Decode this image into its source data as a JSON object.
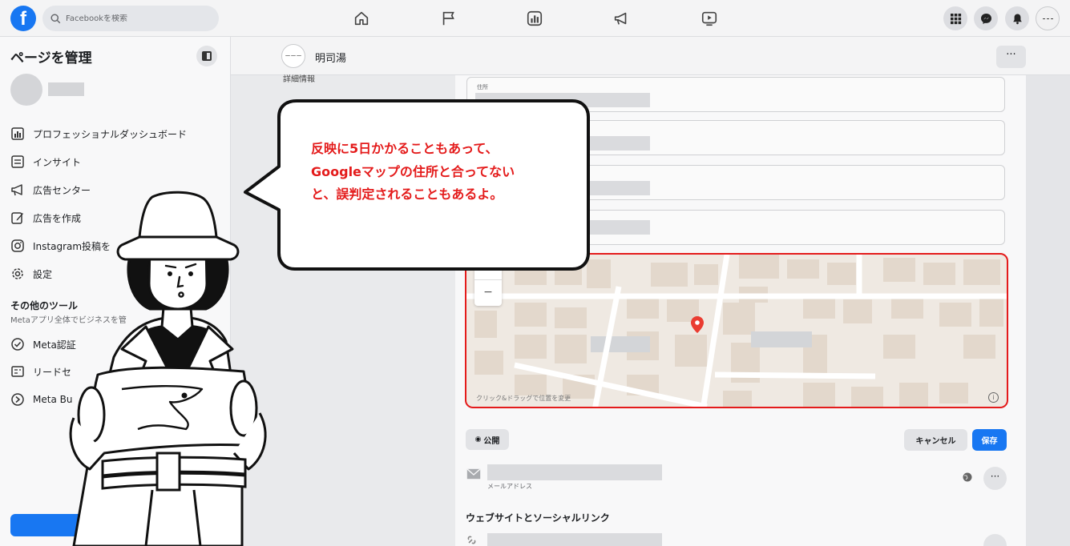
{
  "topbar": {
    "logo": "f",
    "search_placeholder": "Facebookを検索",
    "nav_icons": [
      "home-icon",
      "flag-icon",
      "insights-icon",
      "megaphone-icon",
      "video-icon"
    ],
    "right_icons": [
      "menu-grid-icon",
      "messenger-icon",
      "bell-icon",
      "profile-icon"
    ]
  },
  "sidebar": {
    "title": "ページを管理",
    "items": [
      {
        "label": "プロフェッショナルダッシュボード",
        "icon": "dashboard-icon"
      },
      {
        "label": "インサイト",
        "icon": "insights-icon"
      },
      {
        "label": "広告センター",
        "icon": "megaphone-icon"
      },
      {
        "label": "広告を作成",
        "icon": "edit-icon"
      },
      {
        "label": "Instagram投稿を",
        "icon": "instagram-icon"
      },
      {
        "label": "設定",
        "icon": "gear-icon"
      }
    ],
    "section": {
      "title": "その他のツール",
      "subtitle": "Metaアプリ全体でビジネスを管"
    },
    "tools": [
      {
        "label": "Meta認証",
        "icon": "verified-icon"
      },
      {
        "label": "リードセ",
        "icon": "leads-icon"
      },
      {
        "label": "Meta Bu",
        "icon": "meta-business-icon"
      }
    ]
  },
  "page_header": {
    "avatar_text": "ーーー",
    "page_name": "明司湯"
  },
  "form": {
    "left_label": "詳細情報",
    "address_label": "住所",
    "map_hint": "クリック&ドラッグで位置を変更",
    "map_info": "i",
    "zoom_out": "−",
    "public_label": "公開",
    "cancel_label": "キャンセル",
    "save_label": "保存",
    "email_label": "メールアドレス",
    "website_section": "ウェブサイトとソーシャルリンク",
    "more_label": "···"
  },
  "bubble": {
    "lines": [
      "反映に5日かかることもあって、",
      "Googleマップの住所と合ってない",
      "と、誤判定されることもあるよ。"
    ],
    "text_color": "#e41b1b"
  },
  "colors": {
    "accent": "#1877f2",
    "highlight": "#e41b1b",
    "map_bg": "#efe9e2"
  }
}
